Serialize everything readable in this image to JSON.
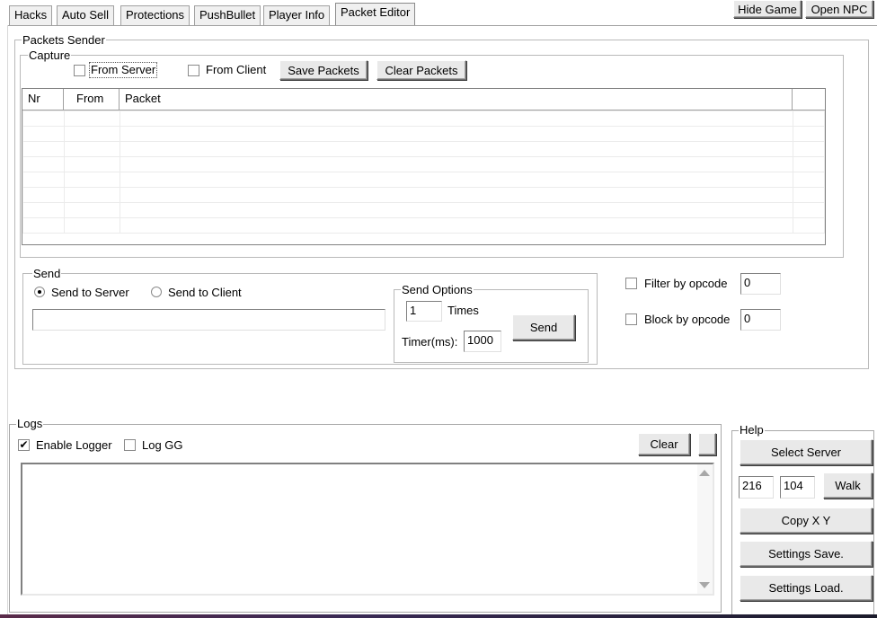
{
  "tabs": [
    {
      "label": "Hacks",
      "active": false
    },
    {
      "label": "Auto Sell",
      "active": false
    },
    {
      "label": "Protections",
      "active": false
    },
    {
      "label": "PushBullet",
      "active": false
    },
    {
      "label": "Player Info",
      "active": false
    },
    {
      "label": "Packet Editor",
      "active": true
    }
  ],
  "top_buttons": {
    "hide_game": "Hide Game",
    "open_npc": "Open NPC"
  },
  "packets_sender": {
    "title": "Packets Sender",
    "capture": {
      "title": "Capture",
      "from_server": {
        "label": "From Server",
        "checked": false
      },
      "from_client": {
        "label": "From Client",
        "checked": false
      },
      "save_packets": "Save Packets",
      "clear_packets": "Clear Packets",
      "columns": [
        "Nr",
        "From",
        "Packet"
      ],
      "rows": []
    },
    "send": {
      "title": "Send",
      "send_to_server": {
        "label": "Send to Server",
        "selected": true
      },
      "send_to_client": {
        "label": "Send to Client",
        "selected": false
      },
      "packet_value": "",
      "options": {
        "title": "Send Options",
        "times_value": "1",
        "times_label": "Times",
        "timer_label": "Timer(ms):",
        "timer_value": "1000",
        "send_button": "Send"
      }
    },
    "filter_by_opcode": {
      "label": "Filter by opcode",
      "checked": false,
      "value": "0"
    },
    "block_by_opcode": {
      "label": "Block by opcode",
      "checked": false,
      "value": "0"
    }
  },
  "logs": {
    "title": "Logs",
    "enable_logger": {
      "label": "Enable Logger",
      "checked": true
    },
    "log_gg": {
      "label": "Log GG",
      "checked": false
    },
    "clear_button": "Clear",
    "content": ""
  },
  "help": {
    "title": "Help",
    "select_server": "Select Server",
    "coord_x": "216",
    "coord_y": "104",
    "walk": "Walk",
    "copy_xy": "Copy X Y",
    "settings_save": "Settings Save.",
    "settings_load": "Settings Load."
  },
  "icons": {
    "check": "check-icon",
    "scroll_up": "scroll-up-icon",
    "scroll_down": "scroll-down-icon"
  }
}
